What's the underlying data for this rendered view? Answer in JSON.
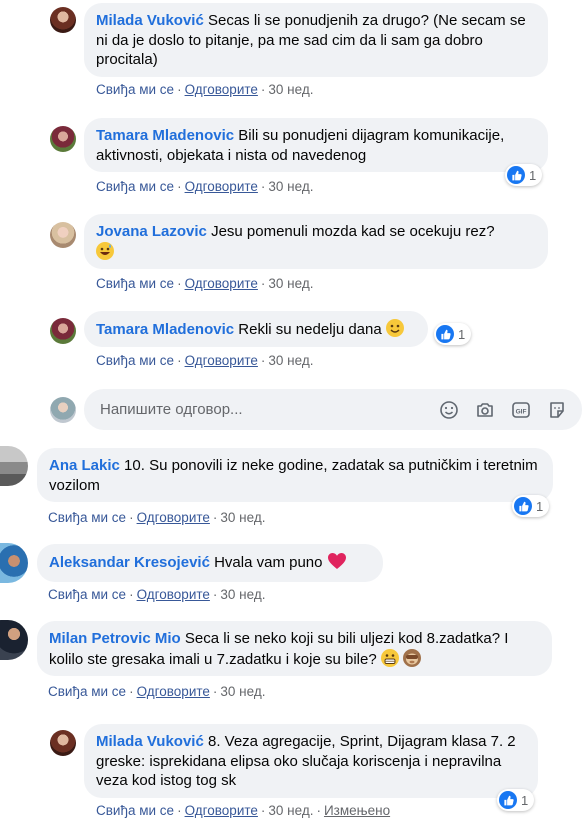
{
  "actions": {
    "like": "Свиђа ми се",
    "reply": "Одговорите",
    "dot": "·",
    "edited": "Измењено"
  },
  "reply_box": {
    "placeholder": "Напишите одговор..."
  },
  "comments": [
    {
      "author": "Milada Vuković",
      "text": "Secas li se ponudjenih za drugo? (Ne secam se ni da je doslo to pitanje, pa me sad cim da li sam ga dobro procitala)",
      "time": "30 нед."
    },
    {
      "author": "Tamara Mladenovic",
      "text": "Bili su ponudjeni dijagram komunikacije, aktivnosti, objekata i nista od navedenog",
      "time": "30 нед.",
      "likes": "1"
    },
    {
      "author": "Jovana Lazovic",
      "text": "Jesu pomenuli mozda kad se ocekuju rez?",
      "time": "30 нед.",
      "emoji": "grinning-sweat-emoji"
    },
    {
      "author": "Tamara Mladenovic",
      "text": "Rekli su nedelju dana",
      "time": "30 нед.",
      "likes": "1",
      "emoji": "smile-emoji"
    },
    {
      "author": "Ana Lakic",
      "text": "10. Su ponovili iz neke godine, zadatak sa putničkim i teretnim vozilom",
      "time": "30 нед.",
      "likes": "1"
    },
    {
      "author": "Aleksandar Kresojević",
      "text": "Hvala vam puno",
      "time": "30 нед.",
      "emoji": "red-heart-emoji"
    },
    {
      "author": "Milan Petrovic Mio",
      "text": "Seca li se neko koji su bili uljezi kod 8.zadatka? I kolilo ste gresaka imali u 7.zadatku i koje su bile?",
      "time": "30 нед.",
      "emoji": "grimacing-emoji, see-no-evil-monkey-emoji"
    },
    {
      "author": "Milada Vuković",
      "text": "8. Veza agregacije, Sprint, Dijagram klasa 7. 2 greske: isprekidana elipsa oko slučaja koriscenja i nepravilna veza kod istog tog sk",
      "time": "30 нед.",
      "likes": "1"
    }
  ],
  "colors": {
    "author": "#216fdb",
    "link": "#385898",
    "bubble": "#f0f2f5",
    "like_badge": "#1877f2",
    "heart": "#e0245e"
  }
}
